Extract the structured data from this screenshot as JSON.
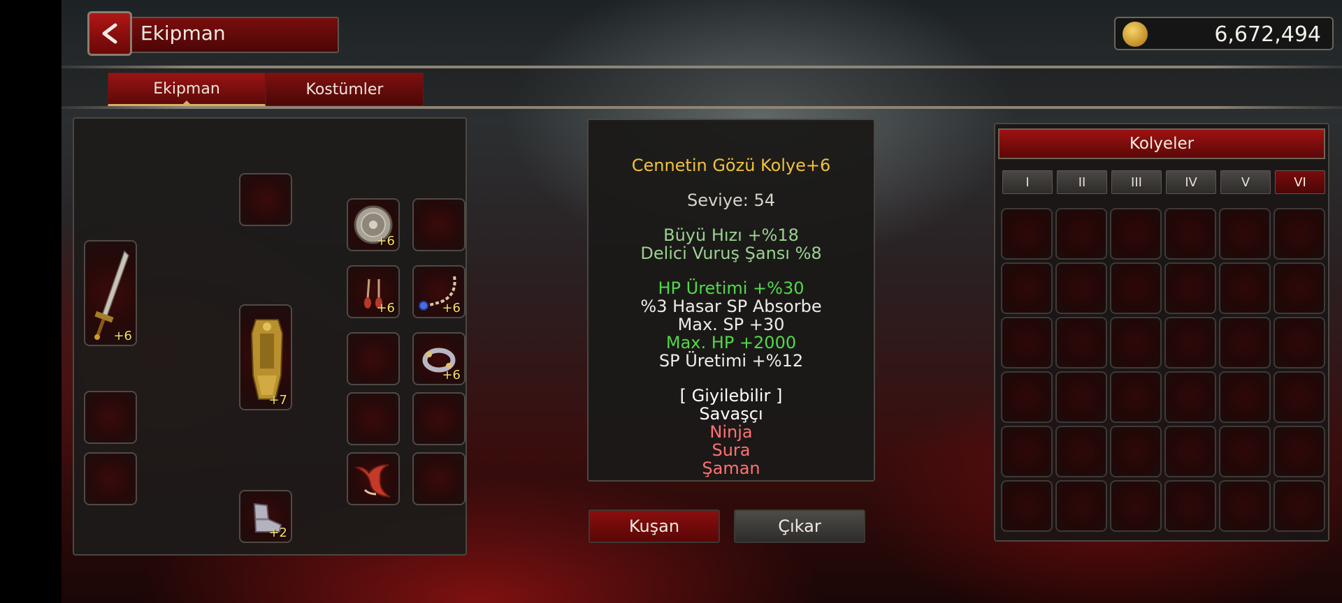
{
  "header": {
    "title": "Ekipman",
    "back_icon": "back-arrow-icon",
    "gold_amount": "6,672,494"
  },
  "tabs": [
    {
      "label": "Ekipman",
      "active": true
    },
    {
      "label": "Kostümler",
      "active": false
    }
  ],
  "equipment": {
    "weapon": {
      "item": "sword",
      "plus": "+6"
    },
    "armor": {
      "item": "golden-armor",
      "plus": "+7"
    },
    "shoes": {
      "item": "boots",
      "plus": "+2"
    },
    "shield": {
      "item": "round-shield",
      "plus": "+6"
    },
    "earrings": {
      "item": "earrings",
      "plus": "+6"
    },
    "necklace": {
      "item": "necklace",
      "plus": "+6"
    },
    "bracelet": {
      "item": "bracelet",
      "plus": "+6"
    },
    "pet": {
      "item": "red-claw",
      "plus": ""
    }
  },
  "tooltip": {
    "name": "Cennetin Gözü Kolye+6",
    "level": "Seviye: 54",
    "bonuses_a": [
      "Büyü Hızı +%18",
      "Delici Vuruş Şansı %8"
    ],
    "bonuses_b": [
      {
        "text": "HP Üretimi +%30",
        "color": "green"
      },
      {
        "text": "%3 Hasar SP Absorbe",
        "color": "white"
      },
      {
        "text": "Max. SP +30",
        "color": "white"
      },
      {
        "text": "Max. HP +2000",
        "color": "green"
      },
      {
        "text": "SP Üretimi +%12",
        "color": "white"
      }
    ],
    "wearable": "[ Giyilebilir ]",
    "classes": [
      {
        "text": "Savaşçı",
        "allowed": true
      },
      {
        "text": "Ninja",
        "allowed": false
      },
      {
        "text": "Sura",
        "allowed": false
      },
      {
        "text": "Şaman",
        "allowed": false
      }
    ]
  },
  "actions": {
    "equip_label": "Kuşan",
    "remove_label": "Çıkar"
  },
  "inventory": {
    "title": "Kolyeler",
    "pages": [
      "I",
      "II",
      "III",
      "IV",
      "V",
      "VI"
    ],
    "active_page": "VI",
    "rows": 6,
    "cols": 6
  },
  "colors": {
    "accent_red": "#8a0e0e",
    "gold_text": "#f1c23d",
    "green_stat": "#52d84a",
    "disallowed_class": "#ff7373",
    "plus_text": "#f5e06a"
  }
}
